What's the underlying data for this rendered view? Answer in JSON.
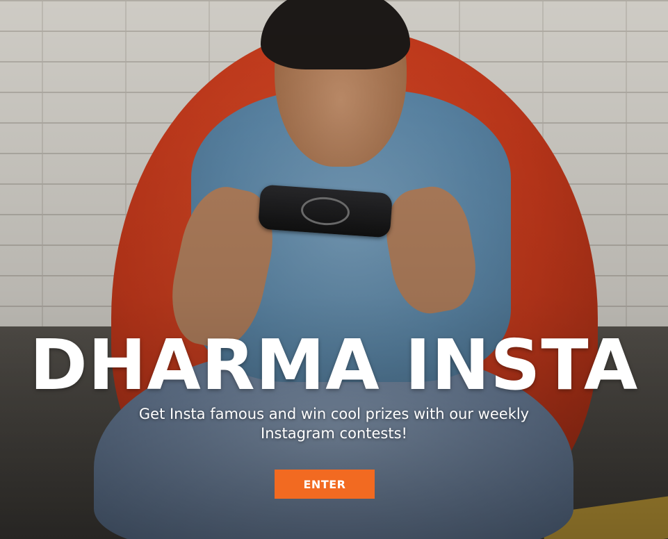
{
  "hero": {
    "title": "DHARMA INSTA",
    "subtitle": "Get Insta famous and win cool prizes with our weekly Instagram contests!",
    "enter_label": "ENTER"
  },
  "colors": {
    "accent": "#f26a21",
    "text": "#ffffff"
  }
}
